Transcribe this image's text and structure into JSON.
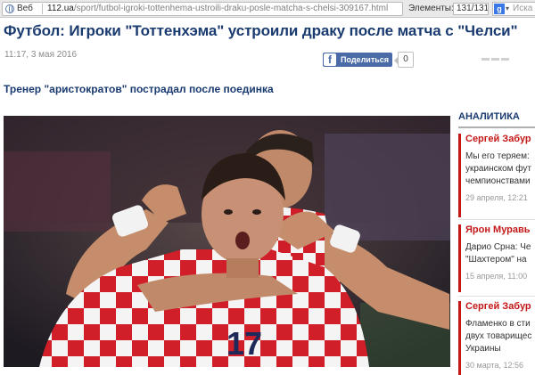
{
  "browser": {
    "web_label": "Веб",
    "url_host": "112.ua",
    "url_path": "/sport/futbol-igroki-tottenhema-ustroili-draku-posle-matcha-s-chelsi-309167.html",
    "elements_label": "Элементы:",
    "elements_count": "131/131",
    "search_placeholder": "Иска"
  },
  "article": {
    "title": "Футбол: Игроки \"Тоттенхэма\" устроили драку после матча с \"Челси\"",
    "date": "11:17, 3 мая 2016",
    "share_label": "Поделиться",
    "share_count": "0",
    "subtitle": "Тренер \"аристократов\" пострадал после поединка",
    "photo_jersey_number": "17"
  },
  "sidebar": {
    "title": "АНАЛИТИКА",
    "items": [
      {
        "author": "Сергей Забур",
        "text1": "Мы его теряем:",
        "text2": "украинском фут",
        "text3": "чемпионствами",
        "date": "29 апреля, 12:21"
      },
      {
        "author": "Ярон Муравь",
        "text1": "Дарио Срна: Че",
        "text2": "\"Шахтером\" на",
        "date": "15 апреля, 11:00"
      },
      {
        "author": "Сергей Забур",
        "text1": "Фламенко в сти",
        "text2": "двух товарищес",
        "text3": "Украины",
        "date": "30 марта, 12:56"
      }
    ]
  },
  "colors": {
    "headline": "#1a3b70",
    "author_red": "#c41818",
    "facebook_blue": "#4a6aa8"
  }
}
